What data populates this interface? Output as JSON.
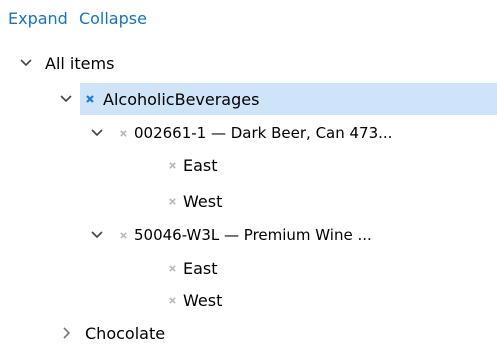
{
  "toolbar": {
    "expand_label": "Expand",
    "collapse_label": "Collapse"
  },
  "tree": {
    "root": {
      "label": "All items",
      "expanded": true
    },
    "alcoholic": {
      "label": "AlcoholicBeverages",
      "expanded": true,
      "selected": true
    },
    "item1": {
      "label": "002661-1 — Dark Beer, Can 473...",
      "expanded": true,
      "children": [
        "East",
        "West"
      ]
    },
    "item2": {
      "label": "50046-W3L — Premium Wine ...",
      "expanded": true,
      "children": [
        "East",
        "West"
      ]
    },
    "chocolate": {
      "label": "Chocolate",
      "expanded": false
    }
  },
  "colors": {
    "link": "#1a73b8",
    "selection_bg": "#cfe4f7",
    "selected_mark": "#1e7bd6",
    "mark": "#b9b9b9",
    "chevron": "#444444"
  }
}
